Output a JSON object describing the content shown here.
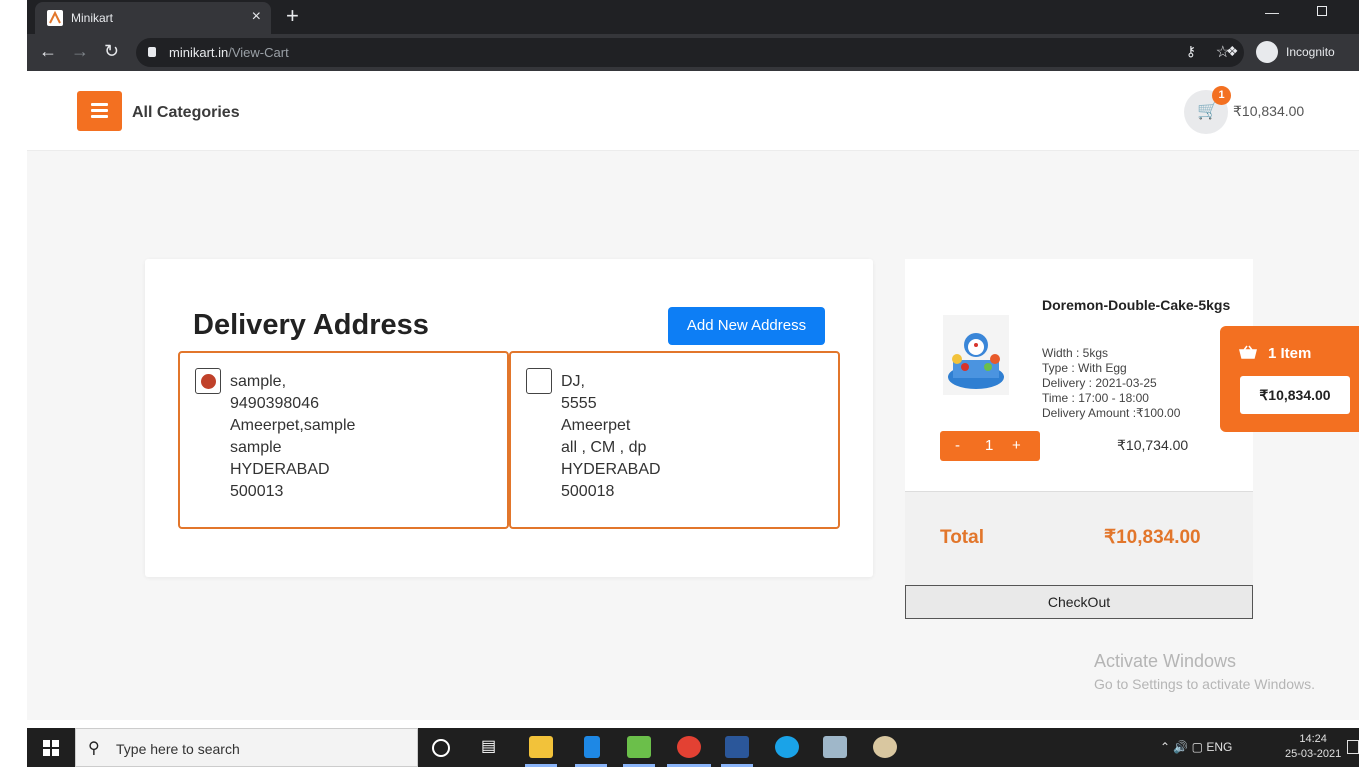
{
  "browser": {
    "tab_title": "Minikart",
    "tab_close": "×",
    "new_tab": "+",
    "url_host": "minikart.in",
    "url_path": "/View-Cart",
    "incognito_label": "Incognito"
  },
  "header": {
    "categories_label": "All Categories",
    "cart_badge": "1",
    "cart_total": "₹10,834.00"
  },
  "delivery": {
    "title": "Delivery Address",
    "add_button": "Add New Address",
    "addresses": [
      {
        "selected": true,
        "lines": [
          "sample,",
          "9490398046",
          "Ameerpet,sample",
          "sample",
          "HYDERABAD",
          "500013"
        ]
      },
      {
        "selected": false,
        "lines": [
          "DJ,",
          "5555",
          "Ameerpet",
          "all , CM , dp",
          "HYDERABAD",
          "500018"
        ]
      }
    ]
  },
  "summary": {
    "product_name": "Doremon-Double-Cake-5kgs",
    "width": "Width : 5kgs",
    "type": "Type : With Egg",
    "delivery": "Delivery : 2021-03-25",
    "time": "Time : 17:00 - 18:00",
    "delivery_amount": "Delivery Amount :₹100.00",
    "qty_minus": "-",
    "qty_value": "1",
    "qty_plus": "+",
    "line_price": "₹10,734.00",
    "total_label": "Total",
    "total_value": "₹10,834.00",
    "checkout_label": "CheckOut"
  },
  "floating_cart": {
    "count_label": "1 Item",
    "price": "₹10,834.00"
  },
  "watermark": {
    "title": "Activate Windows",
    "subtitle": "Go to Settings to activate Windows."
  },
  "taskbar": {
    "search_placeholder": "Type here to search",
    "language": "ENG",
    "time": "14:24",
    "date": "25-03-2021"
  },
  "colors": {
    "accent": "#f37021",
    "address_border": "#e2762b",
    "button_blue": "#0d7ef5"
  }
}
